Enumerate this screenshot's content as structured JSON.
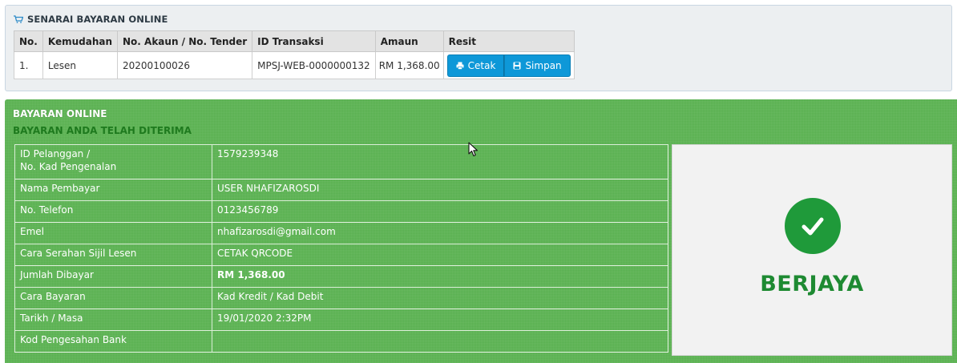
{
  "list_panel": {
    "title": "SENARAI BAYARAN ONLINE",
    "columns": [
      "No.",
      "Kemudahan",
      "No. Akaun / No. Tender",
      "ID Transaksi",
      "Amaun",
      "Resit"
    ],
    "rows": [
      {
        "no": "1.",
        "kemudahan": "Lesen",
        "akaun": "20200100026",
        "transaksi": "MPSJ-WEB-0000000132",
        "amaun": "RM 1,368.00",
        "print_label": "Cetak",
        "save_label": "Simpan"
      }
    ]
  },
  "payment_panel": {
    "title": "BAYARAN ONLINE",
    "subtitle": "BAYARAN ANDA TELAH DITERIMA",
    "details": [
      {
        "label_line1": "ID Pelanggan /",
        "label_line2": "No. Kad Pengenalan",
        "value": "1579239348"
      },
      {
        "label": "Nama Pembayar",
        "value": "USER NHAFIZAROSDI"
      },
      {
        "label": "No. Telefon",
        "value": "0123456789"
      },
      {
        "label": "Emel",
        "value": "nhafizarosdi@gmail.com"
      },
      {
        "label": "Cara Serahan Sijil Lesen",
        "value": "CETAK QRCODE"
      },
      {
        "label": "Jumlah Dibayar",
        "value": "RM 1,368.00"
      },
      {
        "label": "Cara Bayaran",
        "value": "Kad Kredit / Kad Debit"
      },
      {
        "label": "Tarikh / Masa",
        "value": "19/01/2020 2:32PM"
      },
      {
        "label": "Kod Pengesahan Bank",
        "value": ""
      }
    ],
    "status": "BERJAYA"
  },
  "colors": {
    "panel_green": "#57b04e",
    "success_green": "#1f9a3a",
    "button_blue": "#0e98d8"
  },
  "icons": [
    "cart-icon",
    "printer-icon",
    "save-icon",
    "check-circle-icon",
    "mouse-cursor-icon"
  ]
}
